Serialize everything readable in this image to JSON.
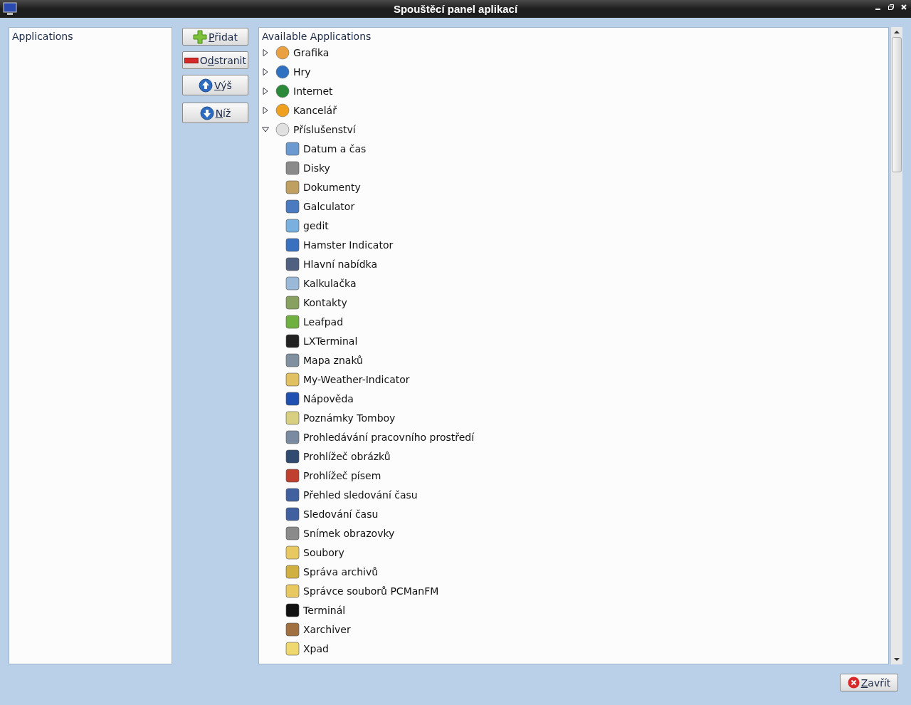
{
  "window": {
    "title": "Spouštěcí panel aplikací"
  },
  "left_panel": {
    "heading": "Applications"
  },
  "buttons": [
    {
      "kind": "add",
      "key": "P",
      "post": "řidat"
    },
    {
      "kind": "remove",
      "pre": "O",
      "key": "d",
      "post": "stranit"
    },
    {
      "kind": "up",
      "key": "V",
      "post": "ýš"
    },
    {
      "kind": "down",
      "key": "N",
      "post": "íž"
    }
  ],
  "tree": {
    "heading": "Available Applications",
    "items": [
      {
        "label": "Grafika",
        "expanded": false
      },
      {
        "label": "Hry",
        "expanded": false
      },
      {
        "label": "Internet",
        "expanded": false
      },
      {
        "label": "Kancelář",
        "expanded": false
      },
      {
        "label": "Příslušenství",
        "expanded": true,
        "children": [
          {
            "label": "Datum a čas"
          },
          {
            "label": "Disky"
          },
          {
            "label": "Dokumenty"
          },
          {
            "label": "Galculator"
          },
          {
            "label": "gedit"
          },
          {
            "label": "Hamster Indicator"
          },
          {
            "label": "Hlavní nabídka"
          },
          {
            "label": "Kalkulačka"
          },
          {
            "label": "Kontakty"
          },
          {
            "label": "Leafpad"
          },
          {
            "label": "LXTerminal"
          },
          {
            "label": "Mapa znaků"
          },
          {
            "label": "My-Weather-Indicator"
          },
          {
            "label": "Nápověda"
          },
          {
            "label": "Poznámky Tomboy"
          },
          {
            "label": "Prohledávání pracovního prostředí"
          },
          {
            "label": "Prohlížeč obrázků"
          },
          {
            "label": "Prohlížeč písem"
          },
          {
            "label": "Přehled sledování času"
          },
          {
            "label": "Sledování času"
          },
          {
            "label": "Snímek obrazovky"
          },
          {
            "label": "Soubory"
          },
          {
            "label": "Správa archivů"
          },
          {
            "label": "Správce souborů PCManFM"
          },
          {
            "label": "Terminál"
          },
          {
            "label": "Xarchiver"
          },
          {
            "label": "Xpad"
          }
        ]
      }
    ]
  },
  "close_button": {
    "key": "Z",
    "post": "avřít"
  }
}
